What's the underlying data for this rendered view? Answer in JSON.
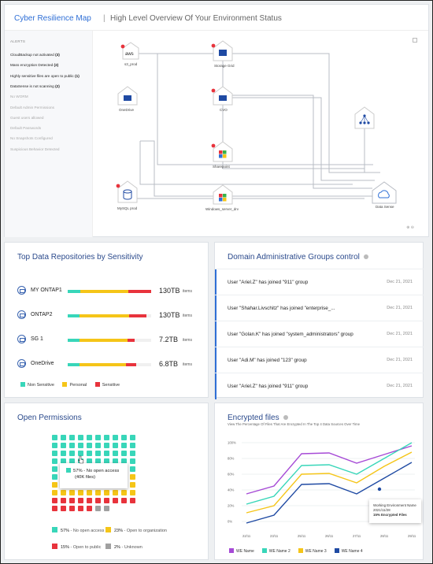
{
  "map": {
    "title": "Cyber Resilience Map",
    "separator": "|",
    "subtitle": "High Level Overview Of Your Environment Status",
    "alerts_heading": "ALERTS",
    "alerts": [
      {
        "label": "CloudBackup not activated",
        "count": "(3)",
        "active": true
      },
      {
        "label": "Mass encryption Detected",
        "count": "(2)",
        "active": true
      },
      {
        "label": "Highly sensitive files are open to public",
        "count": "(1)",
        "active": true
      },
      {
        "label": "DataSense is not scanning",
        "count": "(2)",
        "active": true
      },
      {
        "label": "No WORM",
        "count": "",
        "active": false
      },
      {
        "label": "Default Admin Permissions",
        "count": "",
        "active": false
      },
      {
        "label": "Guest users allowed",
        "count": "",
        "active": false
      },
      {
        "label": "Default Passwords",
        "count": "",
        "active": false
      },
      {
        "label": "No Snapshots Configured",
        "count": "",
        "active": false
      },
      {
        "label": "Suspicious Behavior Detected",
        "count": "",
        "active": false
      }
    ],
    "nodes": {
      "s3": "s3_prod",
      "storagegrid": "Storage Grid",
      "onedrive": "OneDrive",
      "cvo": "CVO",
      "sharepoint": "Sharepoint",
      "mysql": "MySQL prod",
      "windows": "Windows_server_drv",
      "datasense": "Data Sense",
      "aws_text": "aws"
    },
    "zoom_label": "⊕ ⊖"
  },
  "repos": {
    "title": "Top Data Repositories by Sensitivity",
    "unit": "items",
    "colors": {
      "non_sensitive": "#38d6b9",
      "personal": "#f5c518",
      "sensitive": "#e8333c"
    },
    "rows": [
      {
        "name": "MY ONTAP1",
        "size": "130TB",
        "non_sensitive": 0.15,
        "personal": 0.58,
        "sensitive": 0.27
      },
      {
        "name": "ONTAP2",
        "size": "130TB",
        "non_sensitive": 0.14,
        "personal": 0.6,
        "sensitive": 0.2
      },
      {
        "name": "SG 1",
        "size": "7.2TB",
        "non_sensitive": 0.14,
        "personal": 0.58,
        "sensitive": 0.08
      },
      {
        "name": "OneDrive",
        "size": "6.8TB",
        "non_sensitive": 0.14,
        "personal": 0.56,
        "sensitive": 0.12
      }
    ],
    "legend": {
      "non_sensitive": "Non Sensitive",
      "personal": "Personal",
      "sensitive": "Sensitive"
    }
  },
  "groups": {
    "title": "Domain Administrative Groups control",
    "rows": [
      {
        "text": "User \"Ariel.Z\" has joined \"911\" group",
        "date": "Dec 21, 2021"
      },
      {
        "text": "User \"Shahar.Livschitz\" has joined \"enterprise_...",
        "date": "Dec 21, 2021"
      },
      {
        "text": "User \"Golan.K\" has joined \"system_administrators\" group",
        "date": "Dec 21, 2021"
      },
      {
        "text": "User \"Adi.M\" has joined \"123\" group",
        "date": "Dec 21, 2021"
      },
      {
        "text": "User \"Ariel.Z\" has joined \"911\" group",
        "date": "Dec 21, 2021"
      }
    ]
  },
  "permissions": {
    "title": "Open Permissions",
    "tooltip_pct": "57% - No open access",
    "tooltip_sub": "(40K files)",
    "grid": {
      "no_open": 57,
      "org": 23,
      "public": 15,
      "unknown": 2
    },
    "colors": {
      "no_open": "#38d6b9",
      "org": "#f5c518",
      "public": "#e8333c",
      "unknown": "#a0a0a0"
    },
    "legend": [
      {
        "key": "no_open",
        "pct": "57%",
        "desc": "- No open access"
      },
      {
        "key": "org",
        "pct": "23%",
        "desc": "- Open to organization"
      },
      {
        "key": "public",
        "pct": "15%",
        "desc": "- Open to public"
      },
      {
        "key": "unknown",
        "pct": "2%",
        "desc": "- Unknown"
      }
    ]
  },
  "encrypted": {
    "title": "Encrypted files",
    "subtitle": "View The Percentage Of Files That Are Encrypted In The Top 4 Data Sources Over Time",
    "tooltip": {
      "line1": "Working Environment Name",
      "line2": "2021/11/28",
      "line3": "15% Encrypted Files"
    },
    "chart_data": {
      "type": "line",
      "x": [
        "22/11",
        "23/11",
        "25/11",
        "26/11",
        "27/11",
        "28/11",
        "29/11"
      ],
      "yticks": [
        "100%",
        "80%",
        "60%",
        "40%",
        "20%",
        "0%"
      ],
      "ylim": [
        0,
        100
      ],
      "series": [
        {
          "name": "WE Name",
          "color": "#a64ad6",
          "values": [
            35,
            45,
            86,
            87,
            74,
            85,
            96
          ]
        },
        {
          "name": "WE Name 2",
          "color": "#38d6b9",
          "values": [
            22,
            32,
            71,
            72,
            60,
            80,
            100
          ]
        },
        {
          "name": "WE Name 3",
          "color": "#f5c518",
          "values": [
            11,
            20,
            60,
            61,
            49,
            70,
            88
          ]
        },
        {
          "name": "WE Name 4",
          "color": "#1f4aa3",
          "values": [
            -2,
            8,
            47,
            48,
            35,
            55,
            75
          ]
        }
      ]
    }
  }
}
